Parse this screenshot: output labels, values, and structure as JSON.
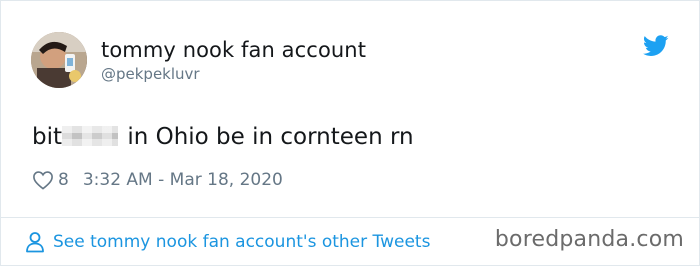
{
  "tweet": {
    "author": {
      "display_name": "tommy nook fan account",
      "handle": "@pekpekluvr",
      "avatar_icon": "avatar-photo"
    },
    "text_before_censor": "bit",
    "text_after_censor": " in Ohio be in cornteen rn",
    "likes": "8",
    "timestamp": "3:32 AM - Mar 18, 2020",
    "platform_icon": "twitter-bird-icon"
  },
  "footer": {
    "link_label": "See tommy nook fan account's other Tweets"
  },
  "watermark": {
    "text": "boredpanda.com"
  },
  "colors": {
    "link_blue": "#1b95e0",
    "muted_gray": "#657786",
    "text_dark": "#14171a",
    "border": "#e1e8ed"
  }
}
